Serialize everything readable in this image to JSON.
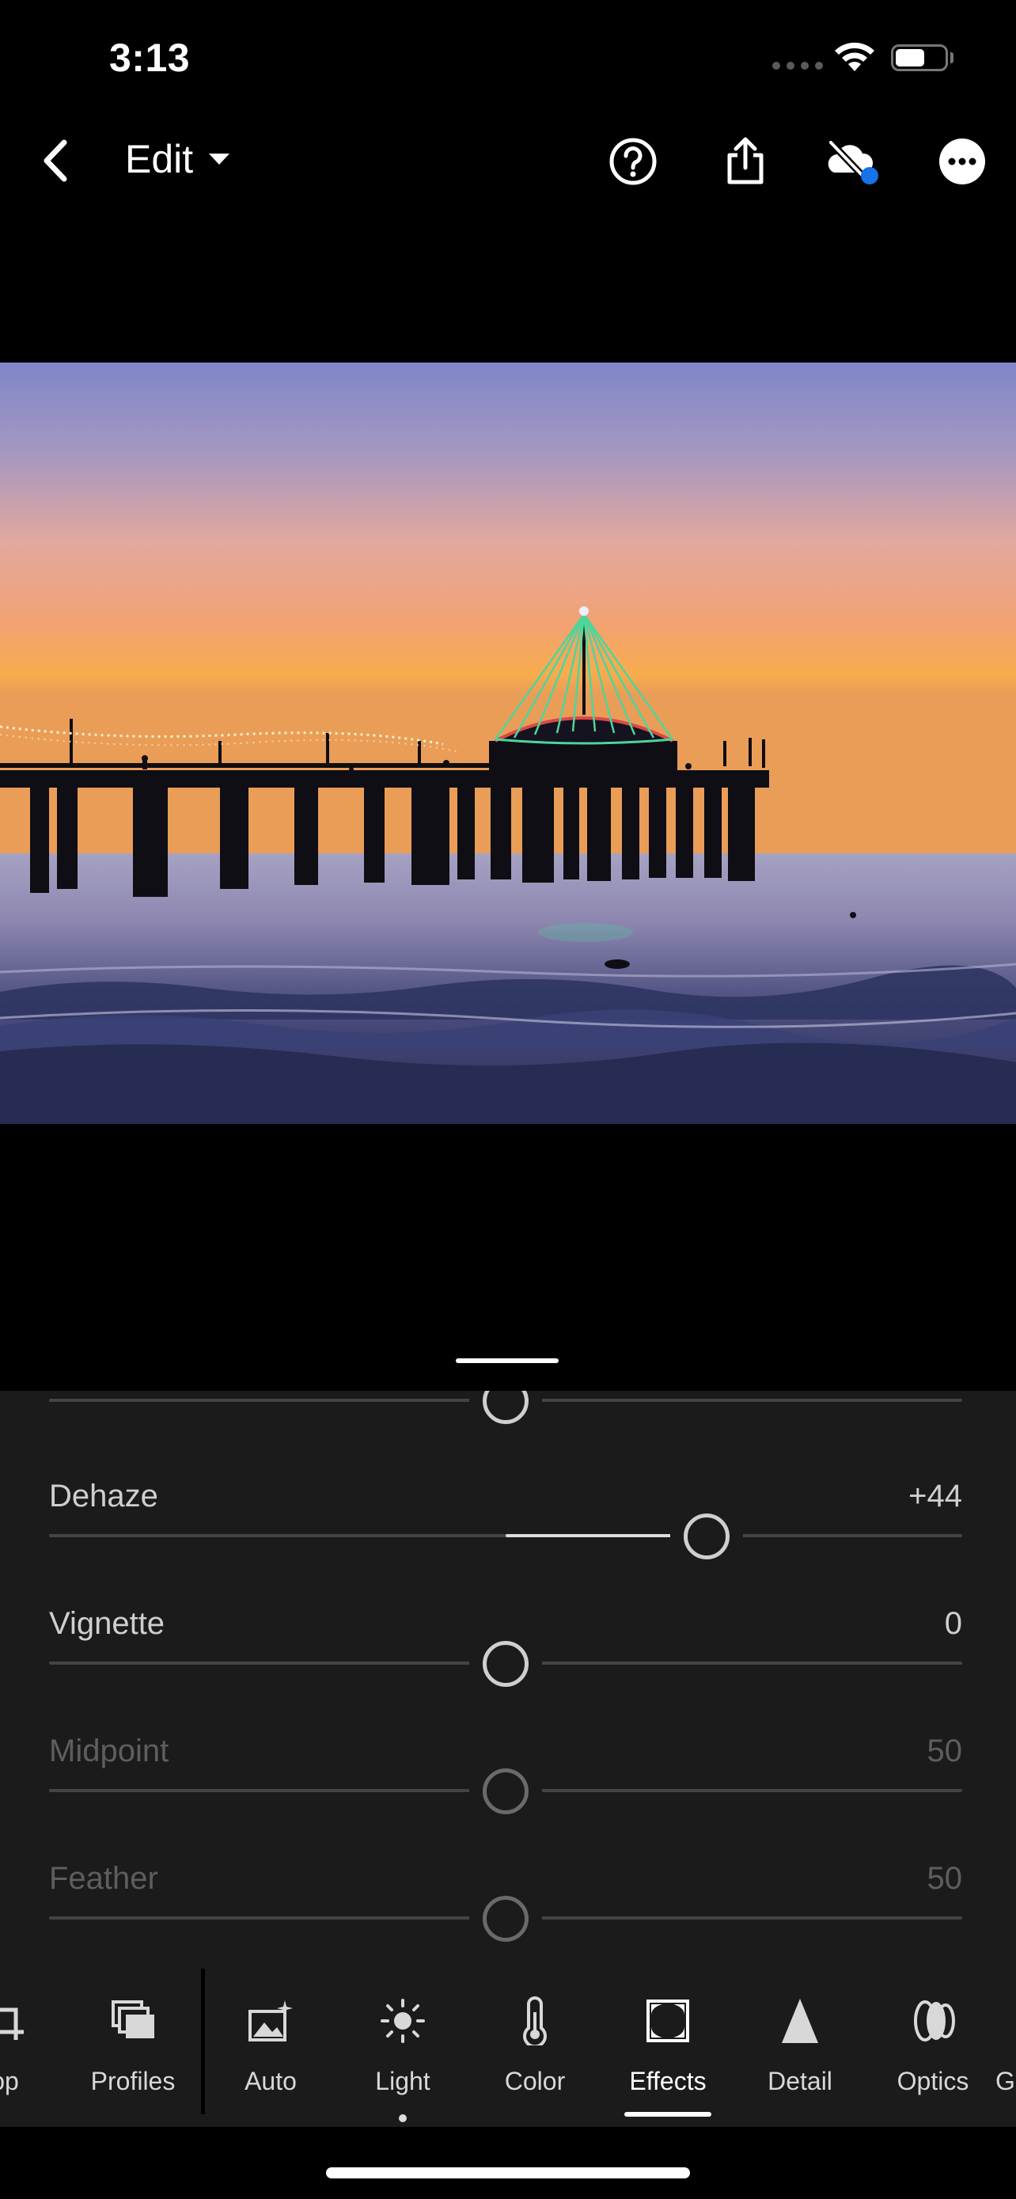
{
  "status_bar": {
    "time": "3:13"
  },
  "toolbar": {
    "back_icon": "chevron-left-icon",
    "edit_label": "Edit",
    "icons": [
      "help-icon",
      "share-icon",
      "cloud-sync-off-icon",
      "more-icon"
    ],
    "sync_badge_color": "#1473e6"
  },
  "adjustments": [
    {
      "label": "",
      "value": "",
      "level": 0.5,
      "fill": false,
      "dim": false
    },
    {
      "label": "Dehaze",
      "value": "+44",
      "level": 0.72,
      "fill": true,
      "dim": false
    },
    {
      "label": "Vignette",
      "value": "0",
      "level": 0.5,
      "fill": false,
      "dim": false
    },
    {
      "label": "Midpoint",
      "value": "50",
      "level": 0.5,
      "fill": false,
      "dim": true
    },
    {
      "label": "Feather",
      "value": "50",
      "level": 0.5,
      "fill": false,
      "dim": true
    }
  ],
  "tabs": [
    {
      "label": "op",
      "icon": "crop-icon"
    },
    {
      "label": "Profiles",
      "icon": "profiles-icon"
    },
    {
      "label": "Auto",
      "icon": "auto-icon"
    },
    {
      "label": "Light",
      "icon": "light-icon",
      "dot": true
    },
    {
      "label": "Color",
      "icon": "color-icon"
    },
    {
      "label": "Effects",
      "icon": "effects-icon",
      "active": true
    },
    {
      "label": "Detail",
      "icon": "detail-icon"
    },
    {
      "label": "Optics",
      "icon": "optics-icon"
    },
    {
      "label": "G",
      "icon": "geometry-icon"
    }
  ]
}
